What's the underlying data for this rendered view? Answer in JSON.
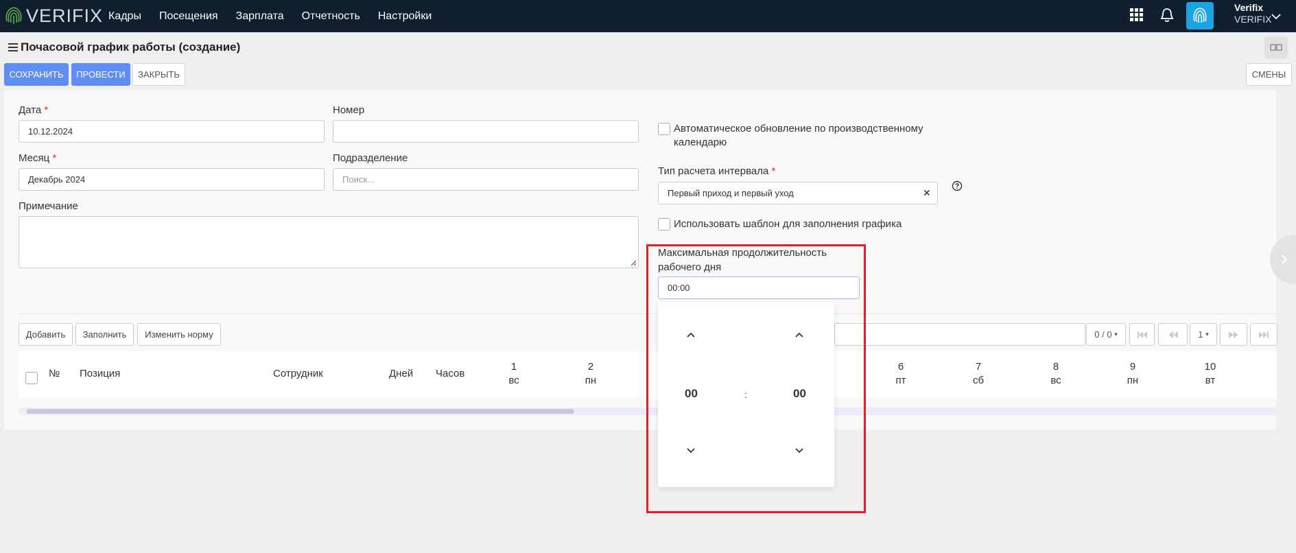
{
  "nav": {
    "brand": "VERIFIX",
    "items": [
      "Кадры",
      "Посещения",
      "Зарплата",
      "Отчетность",
      "Настройки"
    ],
    "user_name": "Verifix",
    "user_org": "VERIFIX"
  },
  "page": {
    "title": "Почасовой график работы (создание)"
  },
  "toolbar": {
    "save": "СОХРАНИТЬ",
    "post": "ПРОВЕСТИ",
    "close": "ЗАКРЫТЬ",
    "shifts": "СМЕНЫ"
  },
  "form": {
    "date_label": "Дата",
    "date_value": "10.12.2024",
    "number_label": "Номер",
    "number_value": "",
    "month_label": "Месяц",
    "month_value": "Декабрь 2024",
    "division_label": "Подразделение",
    "division_placeholder": "Поиск...",
    "note_label": "Примечание",
    "required_mark": "*",
    "auto_update_label_line1": "Автоматическое обновление по производственному",
    "auto_update_label_line2": "календарю",
    "interval_type_label": "Тип расчета интервала",
    "interval_type_value": "Первый приход и первый уход",
    "use_template_label": "Использовать шаблон для заполнения графика",
    "max_duration_label_line1": "Максимальная продолжительность",
    "max_duration_label_line2": "рабочего дня",
    "max_duration_value": "00:00"
  },
  "timepicker": {
    "hours": "00",
    "minutes": "00",
    "separator": ":"
  },
  "table_toolbar": {
    "add": "Добавить",
    "fill": "Заполнить",
    "change_norm": "Изменить норму",
    "count": "0 / 0",
    "page": "1"
  },
  "table": {
    "headers": {
      "num": "№",
      "position": "Позиция",
      "employee": "Сотрудник",
      "days": "Дней",
      "hours": "Часов"
    },
    "day_columns": [
      {
        "day": "1",
        "weekday": "вс"
      },
      {
        "day": "2",
        "weekday": "пн"
      },
      {
        "day": "6",
        "weekday": "пт"
      },
      {
        "day": "7",
        "weekday": "сб"
      },
      {
        "day": "8",
        "weekday": "вс"
      },
      {
        "day": "9",
        "weekday": "пн"
      },
      {
        "day": "10",
        "weekday": "вт"
      }
    ]
  },
  "colors": {
    "topbar": "#0f1f2e",
    "primary": "#5f8df3",
    "highlight": "#ec1c24",
    "avatar": "#1aa4e3"
  }
}
